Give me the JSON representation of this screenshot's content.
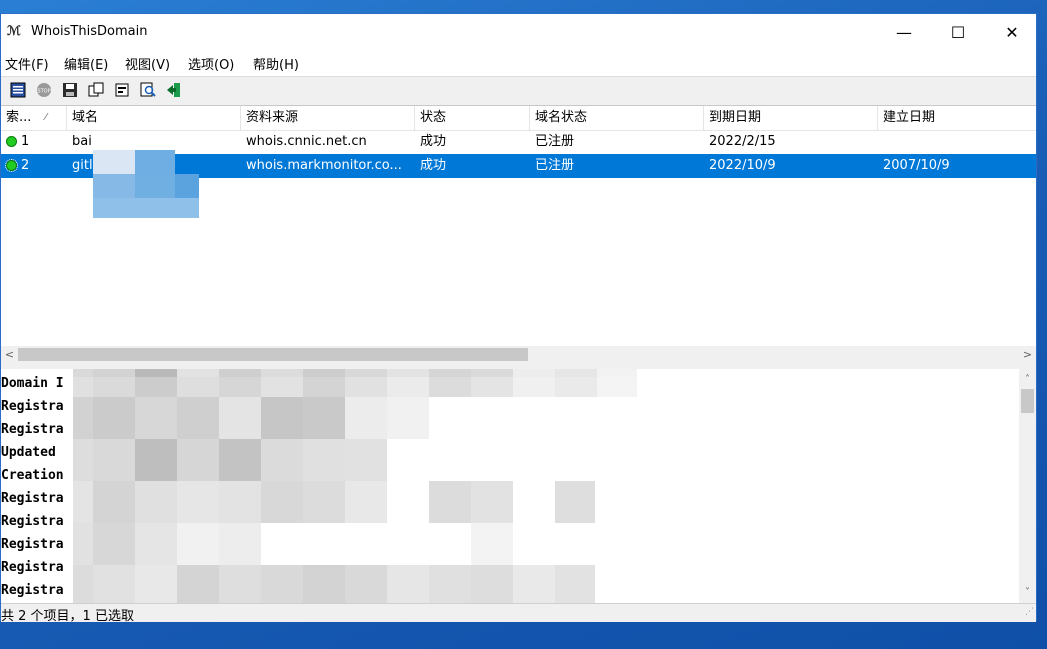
{
  "window": {
    "title": "WhoisThisDomain",
    "icon_text": "W"
  },
  "title_controls": {
    "minimize": "—",
    "maximize": "☐",
    "close": "✕"
  },
  "menu": [
    "文件(F)",
    "编辑(E)",
    "视图(V)",
    "选项(O)",
    "帮助(H)"
  ],
  "toolbar_icons": [
    "list-icon",
    "stop-icon",
    "save-icon",
    "copy-icon",
    "properties-icon",
    "find-icon",
    "exit-icon"
  ],
  "columns": [
    "索...",
    "域名",
    "资料来源",
    "状态",
    "域名状态",
    "到期日期",
    "建立日期"
  ],
  "rows": [
    {
      "index": "1",
      "domain": "bai",
      "source": "whois.cnnic.net.cn",
      "status": "成功",
      "domain_status": "已注册",
      "expiry": "2022/2/15",
      "created": ""
    },
    {
      "index": "2",
      "domain": "gitl",
      "source": "whois.markmonitor.co...",
      "status": "成功",
      "domain_status": "已注册",
      "expiry": "2022/10/9",
      "created": "2007/10/9"
    }
  ],
  "selected_row": 1,
  "whois_lines": [
    "Domain I",
    "Registra",
    "Registra",
    "Updated",
    "Creation",
    "Registra",
    "Registra",
    "Registra",
    "Registra",
    "Registra"
  ],
  "status_bar": "共 2 个项目，1 已选取",
  "colors": {
    "selection": "#0078d7",
    "status_ok": "#22cc22",
    "desktop": "#1a5fb8"
  }
}
